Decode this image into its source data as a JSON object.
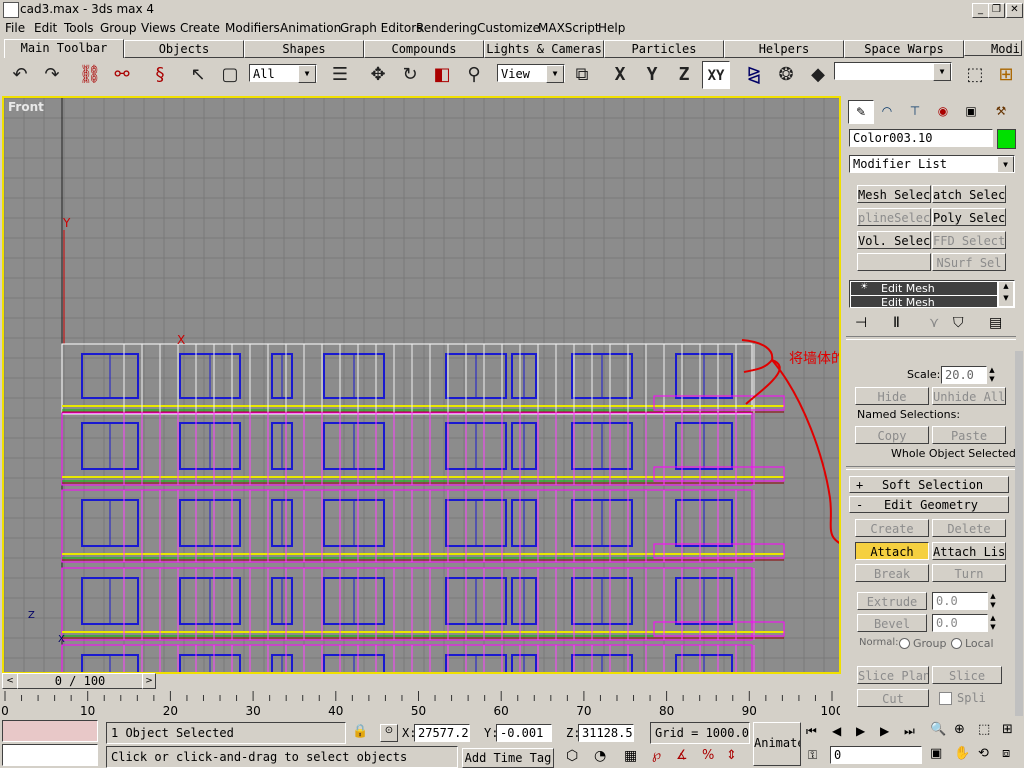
{
  "window": {
    "title": "cad3.max - 3ds max 4",
    "minimize": "_",
    "restore": "❐",
    "close": "✕"
  },
  "menu": [
    "File",
    "Edit",
    "Tools",
    "Group",
    "Views",
    "Create",
    "Modifiers",
    "Animation",
    "Graph Editors",
    "Rendering",
    "Customize",
    "MAXScript",
    "Help"
  ],
  "tabs": [
    "Main Toolbar",
    "Objects",
    "Shapes",
    "Compounds",
    "Lights & Cameras",
    "Particles",
    "Helpers",
    "Space Warps",
    "Modi"
  ],
  "toolbar": {
    "selection_filter": "All",
    "reference_coord": "View",
    "axis_x": "X",
    "axis_y": "Y",
    "axis_z": "Z",
    "axis_xy": "XY"
  },
  "viewport": {
    "label": "Front",
    "annotation": "将墙体的三部分结合！",
    "axis_y_label": "Y",
    "axis_x_label": "X",
    "corner_z": "Z",
    "corner_x": "X"
  },
  "command_panel": {
    "object_name": "Color003.10",
    "object_color": "#00e000",
    "modifier_list": "Modifier List",
    "modifier_buttons": [
      "Mesh Select",
      "atch Select",
      "plineSelect",
      "Poly Select",
      "Vol. Select",
      "FFD Select",
      "",
      "NSurf Sel"
    ],
    "stack": [
      "Edit Mesh",
      "Edit Mesh"
    ],
    "scale_label": "Scale:",
    "scale_value": "20.0",
    "hide": "Hide",
    "unhide_all": "Unhide All",
    "named_selections": "Named Selections:",
    "copy": "Copy",
    "paste": "Paste",
    "whole_object": "Whole Object Selected",
    "soft_selection": "Soft Selection",
    "soft_selection_sign": "+",
    "edit_geometry": "Edit Geometry",
    "edit_geometry_sign": "-",
    "create": "Create",
    "delete": "Delete",
    "attach": "Attach",
    "attach_list": "Attach List",
    "break": "Break",
    "turn": "Turn",
    "extrude": "Extrude",
    "extrude_value": "0.0",
    "bevel": "Bevel",
    "bevel_value": "0.0",
    "normal_label": "Normal:",
    "group_label": "Group",
    "local_label": "Local",
    "slice_plane": "Slice Plan",
    "slice": "Slice",
    "cut": "Cut",
    "split": "Spli"
  },
  "timeline": {
    "frame": "0 / 100",
    "ticks": [
      "0",
      "10",
      "20",
      "30",
      "40",
      "50",
      "60",
      "70",
      "80",
      "90",
      "100"
    ]
  },
  "status": {
    "selected": "1 Object Selected",
    "prompt": "Click or click-and-drag to select objects",
    "x_label": "X:",
    "x": "27577.22",
    "y_label": "Y:",
    "y": "-0.001",
    "z_label": "Z:",
    "z": "31128.52",
    "grid": "Grid = 1000.0",
    "add_time_tag": "Add Time Tag",
    "animate": "Animate",
    "frame_field": "0"
  }
}
